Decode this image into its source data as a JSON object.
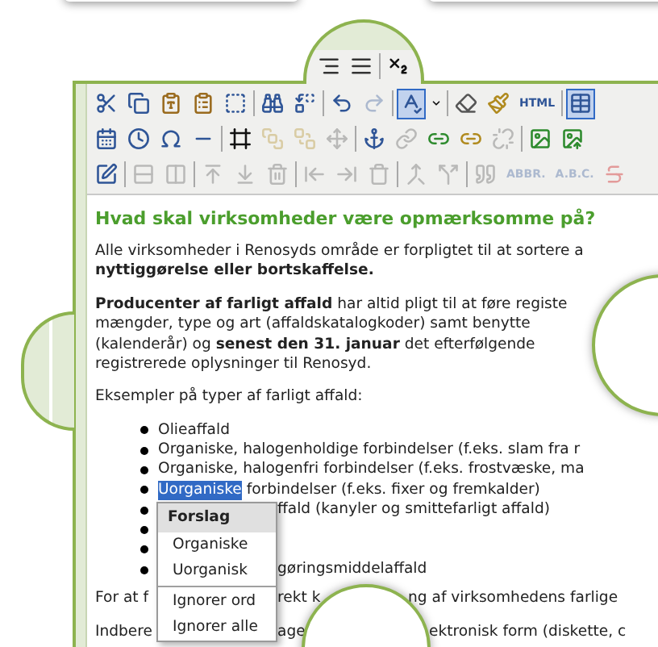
{
  "toolbar": {
    "rows": [
      [
        {
          "kind": "icon",
          "disabled": false,
          "selected": false
        },
        {
          "kind": "icon",
          "disabled": false,
          "selected": false
        },
        {
          "kind": "separator"
        },
        {
          "kind": "icon",
          "disabled": false,
          "selected": false
        }
      ],
      [
        {
          "kind": "icon",
          "disabled": false,
          "selected": false
        },
        {
          "kind": "icon",
          "disabled": false,
          "selected": false
        },
        {
          "kind": "icon",
          "disabled": false,
          "selected": false
        },
        {
          "kind": "icon",
          "disabled": false,
          "selected": false
        },
        {
          "kind": "icon",
          "disabled": false,
          "selected": false
        },
        {
          "kind": "separator"
        },
        {
          "kind": "icon",
          "disabled": false,
          "selected": false
        },
        {
          "kind": "icon",
          "disabled": false,
          "selected": false
        },
        {
          "kind": "separator"
        },
        {
          "kind": "icon",
          "disabled": false,
          "selected": false
        },
        {
          "kind": "icon",
          "disabled": true,
          "selected": false
        },
        {
          "kind": "separator"
        },
        {
          "kind": "icon",
          "disabled": false,
          "selected": true
        },
        {
          "kind": "dropdown",
          "disabled": false,
          "selected": false
        },
        {
          "kind": "separator"
        },
        {
          "kind": "icon",
          "disabled": false,
          "selected": false
        },
        {
          "kind": "icon",
          "disabled": false,
          "selected": false
        },
        {
          "kind": "text",
          "label": "HTML",
          "disabled": false,
          "selected": false
        },
        {
          "kind": "separator"
        },
        {
          "kind": "icon",
          "disabled": false,
          "selected": true
        }
      ],
      [
        {
          "kind": "icon",
          "disabled": false,
          "selected": false
        },
        {
          "kind": "icon",
          "disabled": false,
          "selected": false
        },
        {
          "kind": "icon",
          "disabled": false,
          "selected": false
        },
        {
          "kind": "icon",
          "disabled": false,
          "selected": false
        },
        {
          "kind": "separator"
        },
        {
          "kind": "icon",
          "disabled": false,
          "selected": false
        },
        {
          "kind": "icon",
          "disabled": true,
          "selected": false
        },
        {
          "kind": "icon",
          "disabled": true,
          "selected": false
        },
        {
          "kind": "icon",
          "disabled": true,
          "selected": false
        },
        {
          "kind": "separator"
        },
        {
          "kind": "icon",
          "disabled": false,
          "selected": false
        },
        {
          "kind": "icon",
          "disabled": true,
          "selected": false
        },
        {
          "kind": "icon",
          "disabled": false,
          "selected": false
        },
        {
          "kind": "icon",
          "disabled": false,
          "selected": false
        },
        {
          "kind": "icon",
          "disabled": true,
          "selected": false
        },
        {
          "kind": "separator"
        },
        {
          "kind": "icon",
          "disabled": false,
          "selected": false
        },
        {
          "kind": "icon",
          "disabled": false,
          "selected": false
        }
      ],
      [
        {
          "kind": "icon",
          "disabled": false,
          "selected": false
        },
        {
          "kind": "separator"
        },
        {
          "kind": "icon",
          "disabled": true,
          "selected": false
        },
        {
          "kind": "icon",
          "disabled": true,
          "selected": false
        },
        {
          "kind": "separator"
        },
        {
          "kind": "icon",
          "disabled": true,
          "selected": false
        },
        {
          "kind": "icon",
          "disabled": true,
          "selected": false
        },
        {
          "kind": "icon",
          "disabled": true,
          "selected": false
        },
        {
          "kind": "separator"
        },
        {
          "kind": "icon",
          "disabled": true,
          "selected": false
        },
        {
          "kind": "icon",
          "disabled": true,
          "selected": false
        },
        {
          "kind": "icon",
          "disabled": true,
          "selected": false
        },
        {
          "kind": "separator"
        },
        {
          "kind": "icon",
          "disabled": true,
          "selected": false
        },
        {
          "kind": "icon",
          "disabled": true,
          "selected": false
        },
        {
          "kind": "separator"
        },
        {
          "kind": "icon",
          "disabled": true,
          "selected": false
        },
        {
          "kind": "text",
          "label": "ABBR.",
          "disabled": true,
          "selected": false
        },
        {
          "kind": "text",
          "label": "A.B.C.",
          "disabled": true,
          "selected": false
        },
        {
          "kind": "icon",
          "disabled": true,
          "selected": false
        }
      ]
    ]
  },
  "content": {
    "heading": "Hvad skal virksomheder være opmærksomme på?",
    "blocks": [
      {
        "kind": "paragraph",
        "lines": [
          "Alle virksomheder i Renosyds område er forpligtet til at sortere a",
          "**nyttiggørelse eller bortskaffelse.**"
        ]
      },
      {
        "kind": "paragraph",
        "lines": [
          "**Producenter af farligt affald** har altid pligt til at føre registe",
          "mængder, type og art (affaldskatalogkoder) samt benytte",
          "(kalenderår) og **senest den 31. januar** det efterfølgende",
          "registrerede oplysninger til Renosyd."
        ]
      },
      {
        "kind": "paragraph",
        "lines": [
          "Eksempler på typer af farligt affald:"
        ]
      },
      {
        "kind": "list",
        "items": [
          {
            "kind": "text",
            "text": "Olieaffald"
          },
          {
            "kind": "text",
            "text": "Organiske, halogenholdige forbindelser (f.eks. slam fra r"
          },
          {
            "kind": "text",
            "text": "Organiske, halogenfri forbindelser (f.eks. frostvæske, ma"
          },
          {
            "kind": "text",
            "selected_word": "Uorganiske",
            "text": "forbindelser (f.eks. fixer og fremkalder)"
          },
          {
            "kind": "text",
            "text": "ffald (kanyler og smittefarligt affald)"
          },
          {
            "kind": "bullet_only"
          },
          {
            "kind": "bullet_only"
          },
          {
            "kind": "text",
            "text": "gøringsmiddelaffald"
          }
        ]
      },
      {
        "kind": "fragments",
        "parts": [
          "For at f",
          "rekt k",
          "ng af virksomhedens farlige"
        ]
      },
      {
        "kind": "fragments",
        "parts": [
          "Indbere",
          "age",
          "ektronisk form (diskette, c"
        ]
      }
    ]
  },
  "context_menu": {
    "header": "Forslag",
    "suggestions": [
      "Organiske",
      "Uorganisk"
    ],
    "actions": [
      "Ignorer ord",
      "Ignorer alle"
    ]
  }
}
